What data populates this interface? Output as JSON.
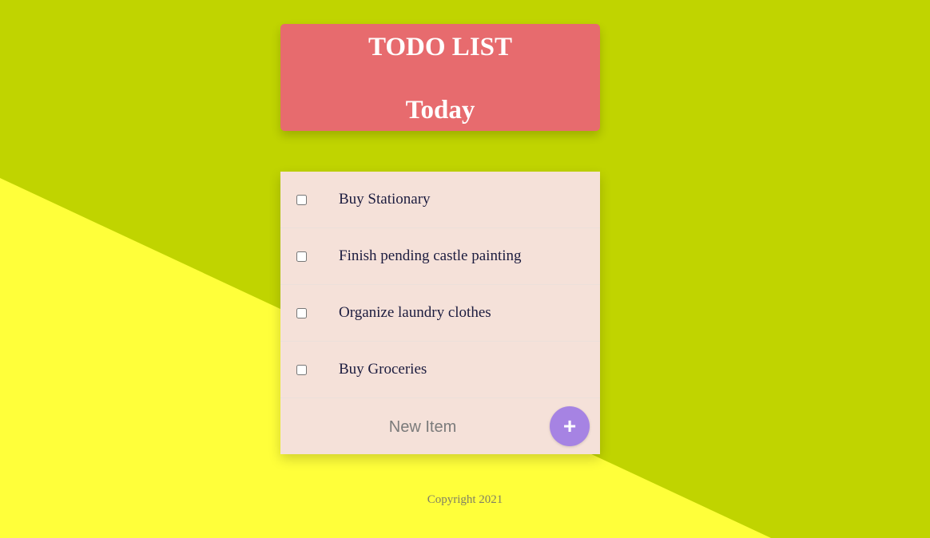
{
  "colors": {
    "background_top": "#c0d400",
    "background_bottom": "#ffff3a",
    "header_card": "#e76b6e",
    "list_card": "#f5e1d9",
    "add_button": "#a683e3"
  },
  "header": {
    "title": "TODO LIST",
    "day": "Today"
  },
  "items": [
    {
      "label": "Buy Stationary",
      "checked": false
    },
    {
      "label": "Finish pending castle painting",
      "checked": false
    },
    {
      "label": "Organize laundry clothes",
      "checked": false
    },
    {
      "label": "Buy Groceries",
      "checked": false
    }
  ],
  "new_item": {
    "placeholder": "New Item",
    "value": "",
    "add_label": "+",
    "add_icon": "plus-icon"
  },
  "footer": {
    "text": "Copyright 2021"
  }
}
